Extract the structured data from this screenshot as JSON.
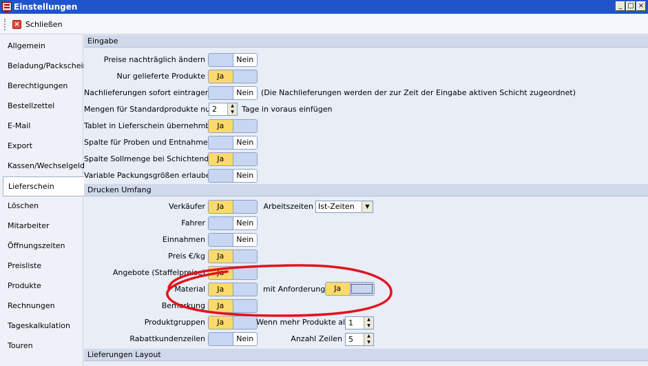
{
  "window": {
    "title": "Einstellungen",
    "minimize": "_",
    "maximize": "□",
    "close": "×"
  },
  "toolbar": {
    "close_label": "Schließen"
  },
  "sidebar": {
    "items": [
      {
        "label": "Allgemein"
      },
      {
        "label": "Beladung/Packschein"
      },
      {
        "label": "Berechtigungen"
      },
      {
        "label": "Bestellzettel"
      },
      {
        "label": "E-Mail"
      },
      {
        "label": "Export"
      },
      {
        "label": "Kassen/Wechselgeld"
      },
      {
        "label": "Lieferschein"
      },
      {
        "label": "Löschen"
      },
      {
        "label": "Mitarbeiter"
      },
      {
        "label": "Öffnungszeiten"
      },
      {
        "label": "Preisliste"
      },
      {
        "label": "Produkte"
      },
      {
        "label": "Rechnungen"
      },
      {
        "label": "Tageskalkulation"
      },
      {
        "label": "Touren"
      }
    ],
    "active": "Lieferschein"
  },
  "toggle_labels": {
    "ja": "Ja",
    "nein": "Nein"
  },
  "eingabe": {
    "header": "Eingabe",
    "preise": {
      "label": "Preise nachträglich ändern",
      "state": "Nein"
    },
    "nur_geliefert": {
      "label": "Nur gelieferte Produkte",
      "state": "Ja"
    },
    "nachlieferungen": {
      "label": "Nachlieferungen sofort eintragen",
      "state": "Nein",
      "note": "(Die Nachlieferungen werden der zur Zeit der Eingabe aktiven Schicht zugeordnet)"
    },
    "mengen": {
      "label": "Mengen für Standardprodukte nur",
      "value": "2",
      "suffix": "Tage in voraus einfügen"
    },
    "tablet": {
      "label": "Tablet in Lieferschein übernehmbar",
      "state": "Ja"
    },
    "spalte_proben": {
      "label": "Spalte für Proben und Entnahmen",
      "state": "Nein"
    },
    "spalte_soll": {
      "label": "Spalte Sollmenge bei Schichtende",
      "state": "Ja"
    },
    "variable": {
      "label": "Variable Packungsgrößen erlauben",
      "state": "Nein"
    }
  },
  "drucken": {
    "header": "Drucken Umfang",
    "verkaeufer": {
      "label": "Verkäufer",
      "state": "Ja"
    },
    "arbeitszeiten": {
      "label": "Arbeitszeiten",
      "value": "Ist-Zeiten"
    },
    "fahrer": {
      "label": "Fahrer",
      "state": "Nein"
    },
    "einnahmen": {
      "label": "Einnahmen",
      "state": "Nein"
    },
    "preis_kg": {
      "label": "Preis €/kg",
      "state": "Ja"
    },
    "angebote": {
      "label": "Angebote (Staffelpreise)",
      "state": "Ja"
    },
    "material": {
      "label": "Material",
      "state": "Ja"
    },
    "mit_anforderung": {
      "label": "mit Anforderung",
      "state": "Ja"
    },
    "bemerkung": {
      "label": "Bemerkung",
      "state": "Ja"
    },
    "produktgruppen": {
      "label": "Produktgruppen",
      "state": "Ja"
    },
    "wenn_mehr": {
      "label": "Wenn mehr Produkte als",
      "value": "1"
    },
    "rabatt": {
      "label": "Rabattkundenzeilen",
      "state": "Nein"
    },
    "anzahl_zeilen": {
      "label": "Anzahl Zeilen",
      "value": "5"
    }
  },
  "lieferungen": {
    "header": "Lieferungen Layout"
  },
  "colors": {
    "titlebar": "#1f54cc",
    "ja_active": "#fcd96c",
    "toggle_blank": "#c8d7f1",
    "annotation": "#e0141e"
  }
}
